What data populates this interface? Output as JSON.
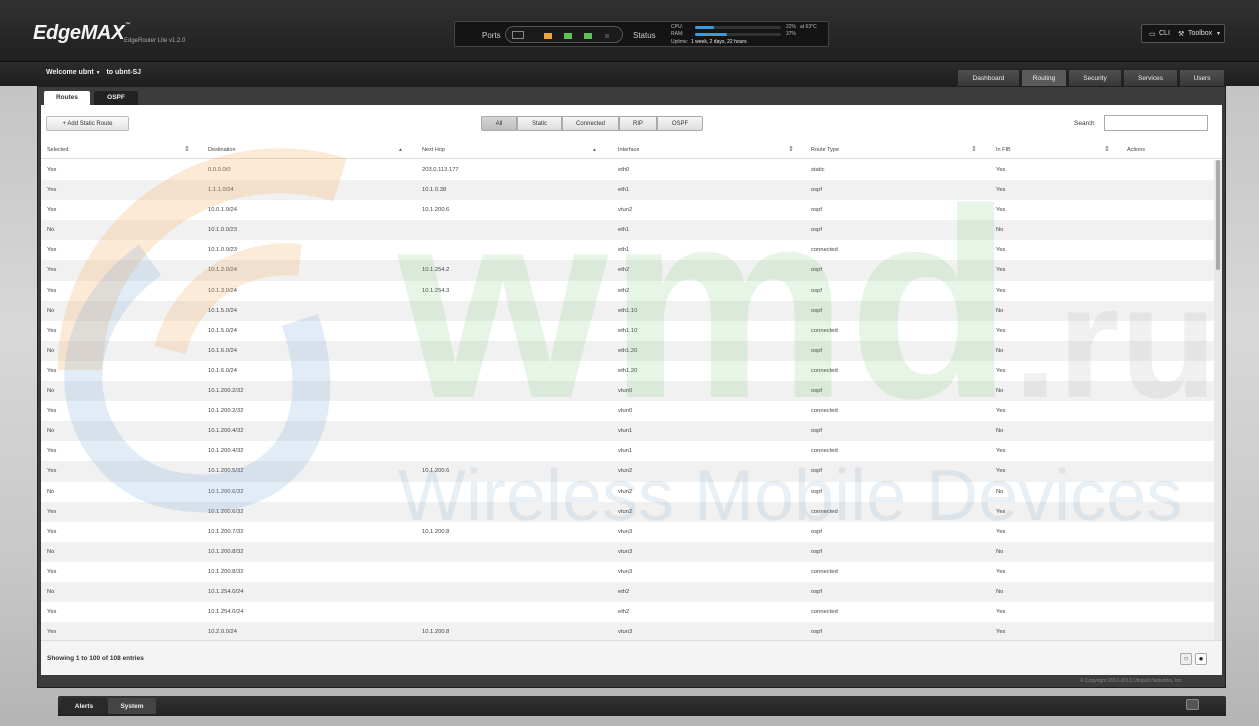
{
  "header": {
    "logo": "EdgeMAX",
    "logo_tm": "™",
    "version": "EdgeRouter Lite v1.2.0",
    "ports_label": "Ports",
    "status_label": "Status",
    "cpu_label": "CPU:",
    "ram_label": "RAM:",
    "cpu_value": "22%",
    "cpu_percent": 22,
    "temp": "at 63°C",
    "ram_value": "37%",
    "ram_percent": 37,
    "uptime_label": "Uptime:",
    "uptime": "1 week, 2 days, 22 hours",
    "cli": "CLI",
    "toolbox": "Toolbox"
  },
  "topbar": {
    "welcome": "Welcome ubnt",
    "to": "to ubnt-SJ",
    "tabs": [
      "Dashboard",
      "Routing",
      "Security",
      "Services",
      "Users"
    ],
    "active_tab": "Routing"
  },
  "subtabs": [
    "Routes",
    "OSPF"
  ],
  "toolbar": {
    "add": "Add Static Route",
    "filters": [
      "All",
      "Static",
      "Connected",
      "RIP",
      "OSPF"
    ],
    "search_label": "Search"
  },
  "columns": [
    "Selected",
    "Destination",
    "Next Hop",
    "Interface",
    "Route Type",
    "In FIB",
    "Actions"
  ],
  "rows": [
    [
      "Yes",
      "0.0.0.0/0",
      "203.0.113.177",
      "eth0",
      "static",
      "Yes"
    ],
    [
      "Yes",
      "1.1.1.0/24",
      "10.1.0.38",
      "eth1",
      "ospf",
      "Yes"
    ],
    [
      "Yes",
      "10.0.1.0/24",
      "10.1.200.6",
      "vtun2",
      "ospf",
      "Yes"
    ],
    [
      "No",
      "10.1.0.0/23",
      "",
      "eth1",
      "ospf",
      "No"
    ],
    [
      "Yes",
      "10.1.0.0/23",
      "",
      "eth1",
      "connected",
      "Yes"
    ],
    [
      "Yes",
      "10.1.2.0/24",
      "10.1.254.2",
      "eth2",
      "ospf",
      "Yes"
    ],
    [
      "Yes",
      "10.1.3.0/24",
      "10.1.254.3",
      "eth2",
      "ospf",
      "Yes"
    ],
    [
      "No",
      "10.1.5.0/24",
      "",
      "eth1.10",
      "ospf",
      "No"
    ],
    [
      "Yes",
      "10.1.5.0/24",
      "",
      "eth1.10",
      "connected",
      "Yes"
    ],
    [
      "No",
      "10.1.6.0/24",
      "",
      "eth1.20",
      "ospf",
      "No"
    ],
    [
      "Yes",
      "10.1.6.0/24",
      "",
      "eth1.20",
      "connected",
      "Yes"
    ],
    [
      "No",
      "10.1.200.2/32",
      "",
      "vtun0",
      "ospf",
      "No"
    ],
    [
      "Yes",
      "10.1.200.2/32",
      "",
      "vtun0",
      "connected",
      "Yes"
    ],
    [
      "No",
      "10.1.200.4/32",
      "",
      "vtun1",
      "ospf",
      "No"
    ],
    [
      "Yes",
      "10.1.200.4/32",
      "",
      "vtun1",
      "connected",
      "Yes"
    ],
    [
      "Yes",
      "10.1.200.5/32",
      "10.1.200.6",
      "vtun2",
      "ospf",
      "Yes"
    ],
    [
      "No",
      "10.1.200.6/32",
      "",
      "vtun2",
      "ospf",
      "No"
    ],
    [
      "Yes",
      "10.1.200.6/32",
      "",
      "vtun2",
      "connected",
      "Yes"
    ],
    [
      "Yes",
      "10.1.200.7/32",
      "10.1.200.8",
      "vtun3",
      "ospf",
      "Yes"
    ],
    [
      "No",
      "10.1.200.8/32",
      "",
      "vtun3",
      "ospf",
      "No"
    ],
    [
      "Yes",
      "10.1.200.8/32",
      "",
      "vtun3",
      "connected",
      "Yes"
    ],
    [
      "No",
      "10.1.254.0/24",
      "",
      "eth2",
      "ospf",
      "No"
    ],
    [
      "Yes",
      "10.1.254.0/24",
      "",
      "eth2",
      "connected",
      "Yes"
    ],
    [
      "Yes",
      "10.2.0.0/24",
      "10.1.200.8",
      "vtun3",
      "ospf",
      "Yes"
    ]
  ],
  "footer": {
    "showing": "Showing 1 to 100 of 108 entries",
    "copyright": "© Copyright 2012-2013 Ubiquiti Networks, Inc."
  },
  "bottom_tabs": [
    "Alerts",
    "System"
  ],
  "watermark": {
    "main": "wmd",
    "tld": ".ru",
    "tagline": "Wireless Mobile Devices"
  },
  "colors": {
    "accent": "#3a9ce0",
    "port_orange": "#f0a23a",
    "port_green": "#5fc05a"
  }
}
